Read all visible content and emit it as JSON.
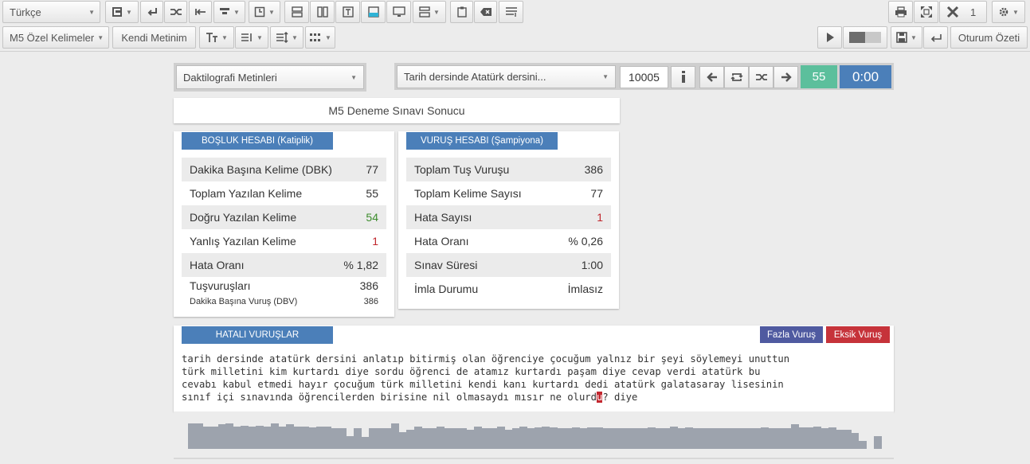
{
  "toolbar": {
    "language": "Türkçe",
    "close_count": "1",
    "custom_words": "M5 Özel Kelimeler",
    "own_text": "Kendi Metinim",
    "session_summary": "Oturum Özeti"
  },
  "selectors": {
    "category": "Daktilografi Metinleri",
    "text_title": "Tarih dersinde Atatürk dersini...",
    "text_id": "10005",
    "word_count": "55",
    "timer": "0:00"
  },
  "result": {
    "title": "M5 Deneme Sınavı Sonucu"
  },
  "spacing_panel": {
    "header": "BOŞLUK HESABI (Katiplik)",
    "rows": [
      {
        "label": "Dakika Başına Kelime (DBK)",
        "value": "77"
      },
      {
        "label": "Toplam Yazılan Kelime",
        "value": "55"
      },
      {
        "label": "Doğru Yazılan Kelime",
        "value": "54"
      },
      {
        "label": "Yanlış Yazılan Kelime",
        "value": "1"
      },
      {
        "label": "Hata Oranı",
        "value": "% 1,82"
      }
    ],
    "keystrokes_label": "Tuşvuruşları",
    "keystrokes_value": "386",
    "dbv_label": "Dakika Başına Vuruş (DBV)",
    "dbv_value": "386"
  },
  "stroke_panel": {
    "header": "VURUŞ HESABI (Şampiyona)",
    "rows": [
      {
        "label": "Toplam Tuş Vuruşu",
        "value": "386"
      },
      {
        "label": "Toplam Kelime Sayısı",
        "value": "77"
      },
      {
        "label": "Hata Sayısı",
        "value": "1"
      },
      {
        "label": "Hata Oranı",
        "value": "% 0,26"
      },
      {
        "label": "Sınav Süresi",
        "value": "1:00"
      },
      {
        "label": "İmla Durumu",
        "value": "İmlasız"
      }
    ]
  },
  "errors_panel": {
    "header": "HATALI VURUŞLAR",
    "extra_btn": "Fazla Vuruş",
    "missing_btn": "Eksik Vuruş",
    "lines": [
      "tarih dersinde atatürk dersini anlatıp bitirmiş olan öğrenciye çocuğum yalnız bir şeyi söylemeyi unuttun",
      "türk milletini kim kurtardı diye sordu öğrenci de atamız kurtardı paşam diye cevap verdi atatürk bu",
      "cevabı kabul etmedi hayır çocuğum türk milletini kendi kanı kurtardı dedi atatürk galatasaray lisesinin"
    ],
    "last_line_before": "sınıf içi sınavında öğrencilerden birisine nil olmasaydı mısır ne olurd",
    "error_char": "u",
    "last_line_after": "? diye"
  },
  "speed_bars": [
    0.68,
    0.68,
    0.6,
    0.6,
    0.65,
    0.68,
    0.6,
    0.62,
    0.6,
    0.62,
    0.6,
    0.68,
    0.6,
    0.65,
    0.6,
    0.6,
    0.58,
    0.6,
    0.6,
    0.55,
    0.55,
    0.35,
    0.55,
    0.32,
    0.55,
    0.55,
    0.55,
    0.68,
    0.45,
    0.5,
    0.6,
    0.55,
    0.55,
    0.6,
    0.55,
    0.55,
    0.55,
    0.5,
    0.6,
    0.55,
    0.55,
    0.6,
    0.5,
    0.55,
    0.6,
    0.55,
    0.58,
    0.6,
    0.58,
    0.55,
    0.55,
    0.58,
    0.55,
    0.58,
    0.58,
    0.55,
    0.55,
    0.55,
    0.55,
    0.55,
    0.55,
    0.58,
    0.55,
    0.55,
    0.6,
    0.55,
    0.58,
    0.55,
    0.55,
    0.55,
    0.55,
    0.55,
    0.55,
    0.55,
    0.55,
    0.55,
    0.58,
    0.55,
    0.55,
    0.55,
    0.65,
    0.58,
    0.58,
    0.6,
    0.55,
    0.58,
    0.52,
    0.5,
    0.42,
    0.22,
    0.0,
    0.35
  ],
  "colors": {
    "tag_blue": "#4b7fb9",
    "count_green": "#5cbf9c",
    "timer_blue": "#4b7fb9",
    "extra_btn": "#4f5aa0",
    "missing_btn": "#c6333a"
  }
}
